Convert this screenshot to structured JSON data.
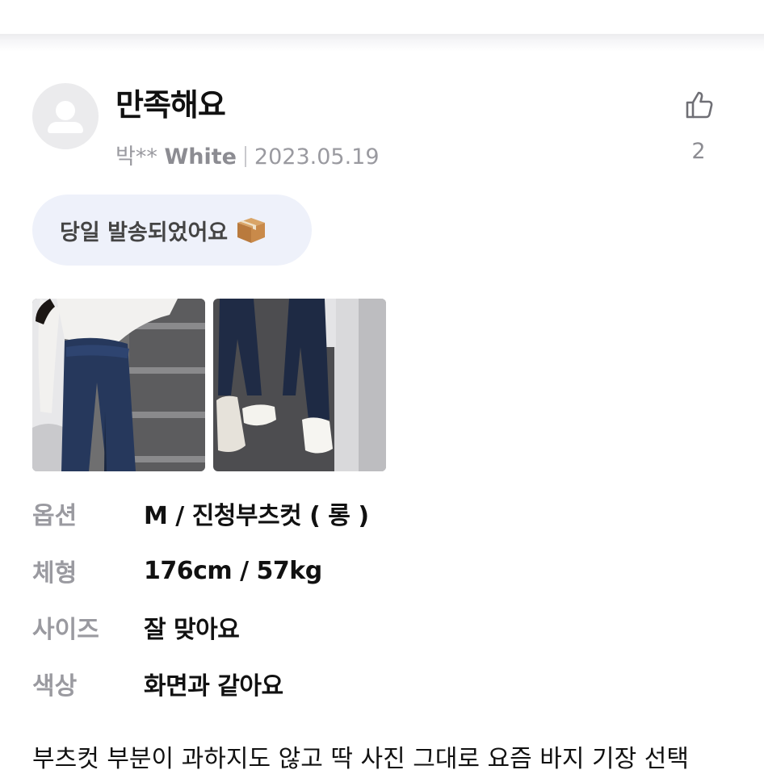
{
  "review": {
    "title": "만족해요",
    "reviewer": "박**",
    "purchased_color": "White",
    "date": "2023.05.19",
    "like_count": "2",
    "tag": "당일 발송되었어요",
    "tag_icon": "package-icon",
    "photos": [
      "review-photo-1",
      "review-photo-2"
    ],
    "options": [
      {
        "label": "옵션",
        "value": "M / 진청부츠컷 ( 롱 )"
      },
      {
        "label": "체형",
        "value": "176cm / 57kg"
      },
      {
        "label": "사이즈",
        "value": "잘 맞아요"
      },
      {
        "label": "색상",
        "value": "화면과 같아요"
      }
    ],
    "body": "부츠컷 부분이 과하지도 않고 딱 사진 그대로 요즘 바지 기장 선택"
  },
  "colors": {
    "accent_tag_bg": "#eef1fa",
    "muted_text": "#9a9aa0"
  }
}
